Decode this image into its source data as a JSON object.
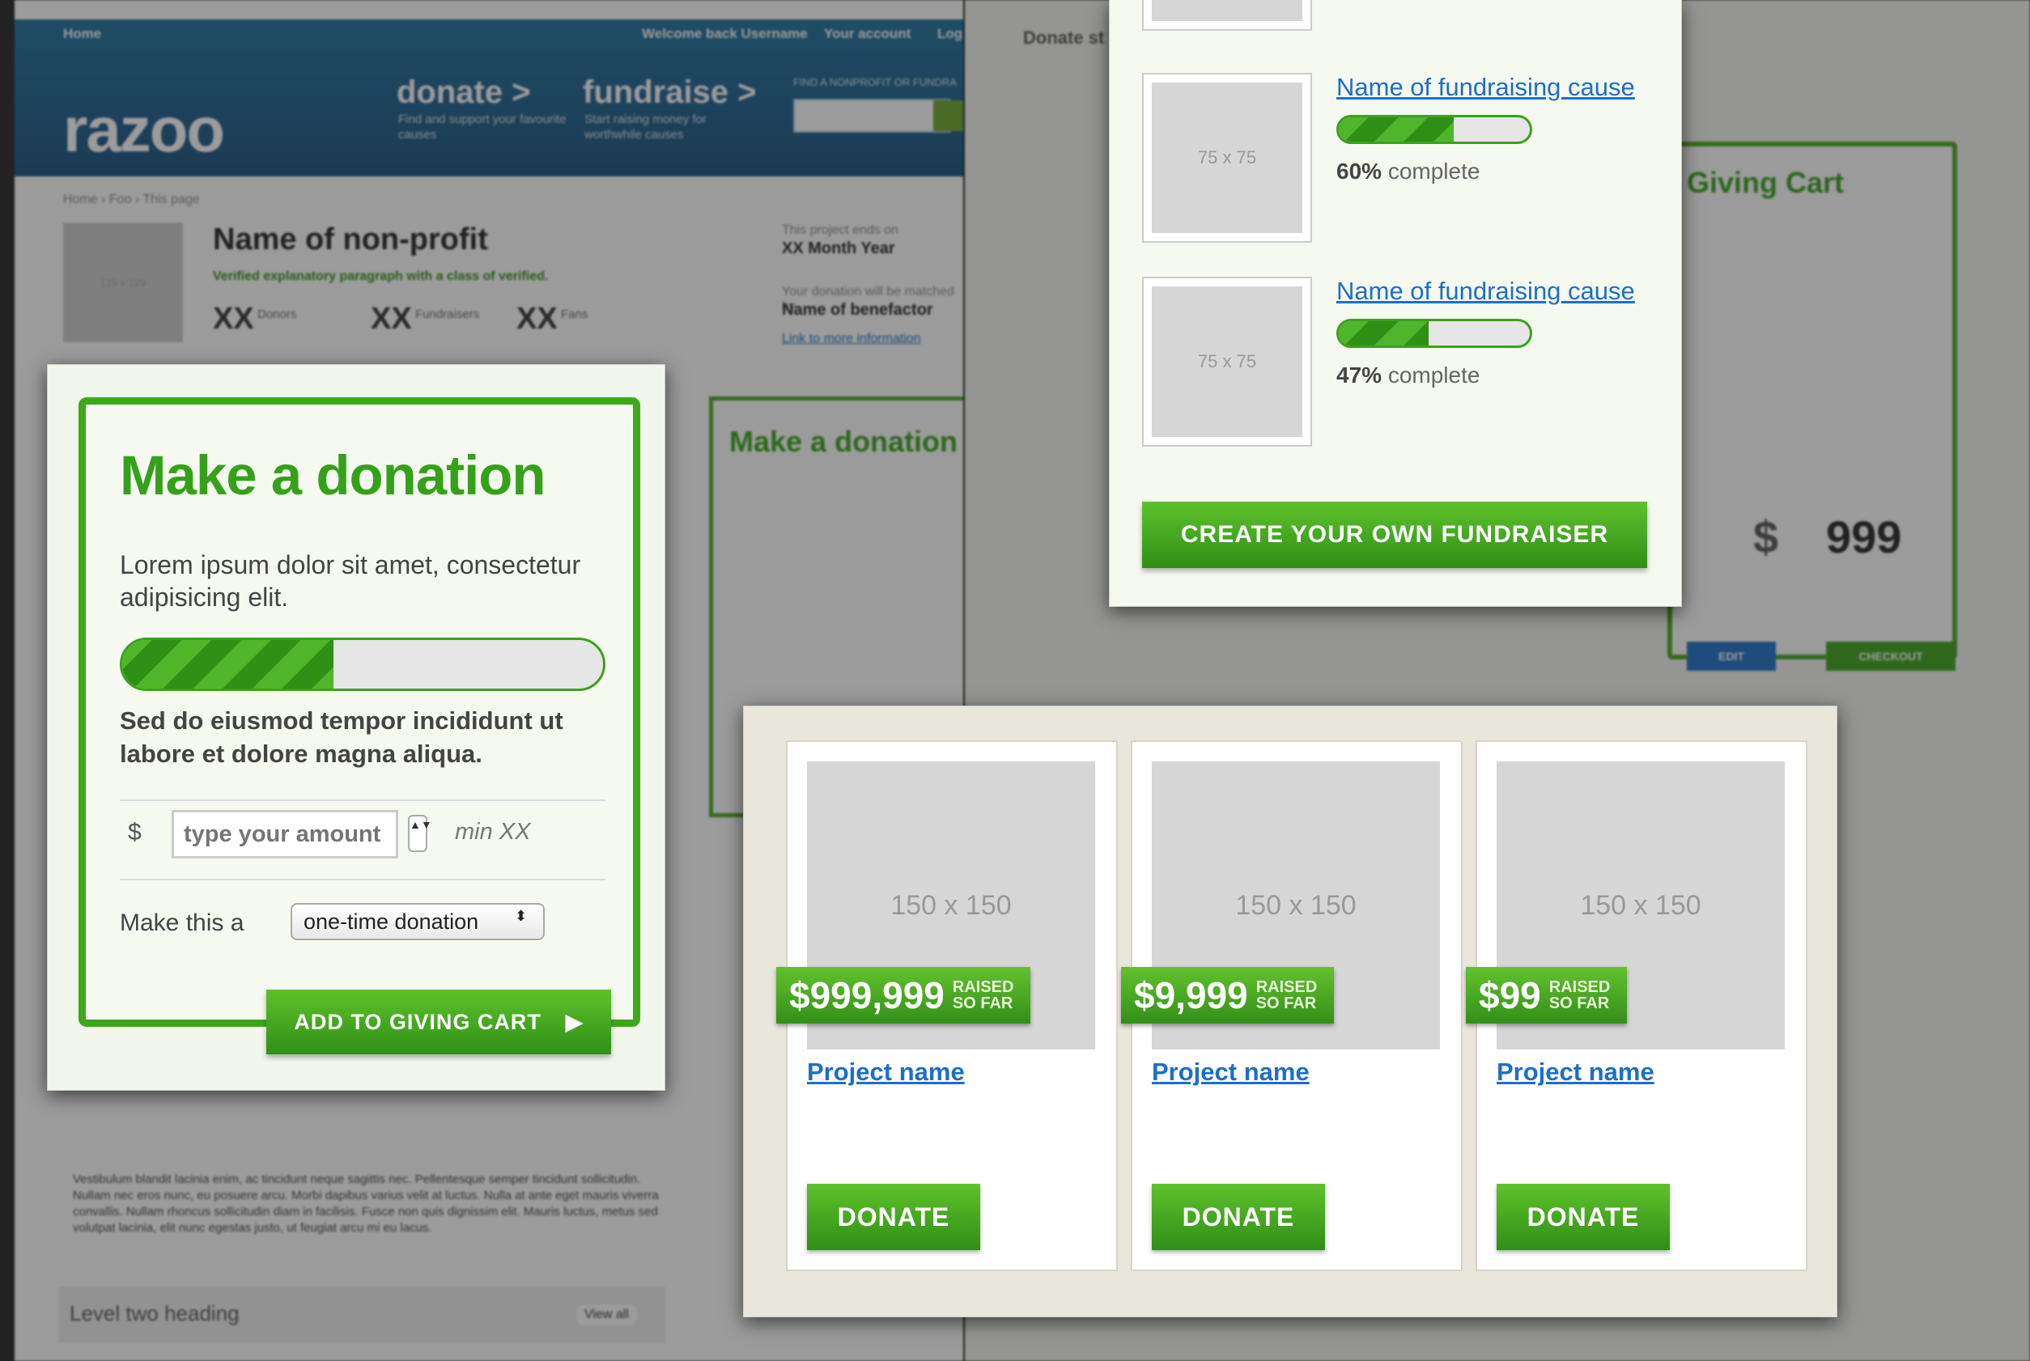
{
  "site": {
    "topnav": {
      "home": "Home",
      "welcome": "Welcome back Username",
      "account": "Your account",
      "log": "Log"
    },
    "logo": "razoo",
    "nav": [
      {
        "title": "donate >",
        "sub": "Find and support your favourite causes"
      },
      {
        "title": "fundraise >",
        "sub": "Start raising money for worthwhile causes"
      }
    ],
    "find_label": "FIND A NONPROFIT OR FUNDRA",
    "breadcrumb": "Home › Foo › This page",
    "nonprofit": {
      "thumb": "129 x 129",
      "name": "Name of non-profit",
      "verified": "Verified explanatory paragraph with a class of verified.",
      "stats": [
        {
          "num": "XX",
          "label": "Donors"
        },
        {
          "num": "XX",
          "label": "Fundraisers"
        },
        {
          "num": "XX",
          "label": "Fans"
        }
      ],
      "ends_label": "This project ends on",
      "ends_value": "XX Month Year",
      "match_label": "Your donation will be matched by",
      "match_value": "Name of benefactor",
      "more_link": "Link to more information"
    },
    "side_title": "Make a donation",
    "lower_text": "Vestibulum blandit lacinia enim, ac tincidunt neque sagittis nec. Pellentesque semper tincidunt sollicitudin. Nullam nec eros nunc, eu posuere arcu. Morbi dapibus varius velit at luctus. Nulla at ante eget mauris viverra convallis. Nullam rhoncus sollicitudin diam in facilisis. Fusce non quis dignissim elit. Mauris luctus, metus sed volutpat lacinia, elit nunc egestas justo, ut feugiat arcu mi eu lacus.",
    "level2": "Level two heading",
    "view_all": "View all",
    "cart": {
      "title": "Giving Cart",
      "amount_symbol": "$",
      "amount": "999",
      "edit": "EDIT",
      "checkout": "CHECKOUT"
    },
    "donate_st": "Donate st"
  },
  "donation": {
    "title": "Make a donation",
    "lead": "Lorem ipsum dolor sit amet, consectetur adipisicing elit.",
    "progress": 0.44,
    "bold": "Sed do eiusmod tempor incididunt ut labore et dolore magna aliqua.",
    "currency": "$",
    "amount_placeholder": "type your amount",
    "spin": "▲▼",
    "min": "min XX",
    "make_label": "Make this a",
    "frequency": "one-time donation",
    "add_button": "ADD TO GIVING CART",
    "add_arrow": "▶"
  },
  "causes": {
    "items": [
      {
        "thumb": "75 x 75",
        "name": "Name of fundraising cause",
        "progress": 0.6,
        "pct": "60%",
        "suffix": "complete"
      },
      {
        "thumb": "75 x 75",
        "name": "Name of fundraising cause",
        "progress": 0.47,
        "pct": "47%",
        "suffix": "complete"
      }
    ],
    "create_button": "CREATE YOUR OWN FUNDRAISER"
  },
  "projects": [
    {
      "img": "150 x 150",
      "raised": "$999,999",
      "raised_label": "RAISED SO FAR",
      "name": "Project name",
      "button": "DONATE"
    },
    {
      "img": "150 x 150",
      "raised": "$9,999",
      "raised_label": "RAISED SO FAR",
      "name": "Project name",
      "button": "DONATE"
    },
    {
      "img": "150 x 150",
      "raised": "$99",
      "raised_label": "RAISED SO FAR",
      "name": "Project name",
      "button": "DONATE"
    }
  ],
  "colors": {
    "accent": "#3da81a",
    "link": "#1e6ec8",
    "header": "#1d6f9e"
  }
}
